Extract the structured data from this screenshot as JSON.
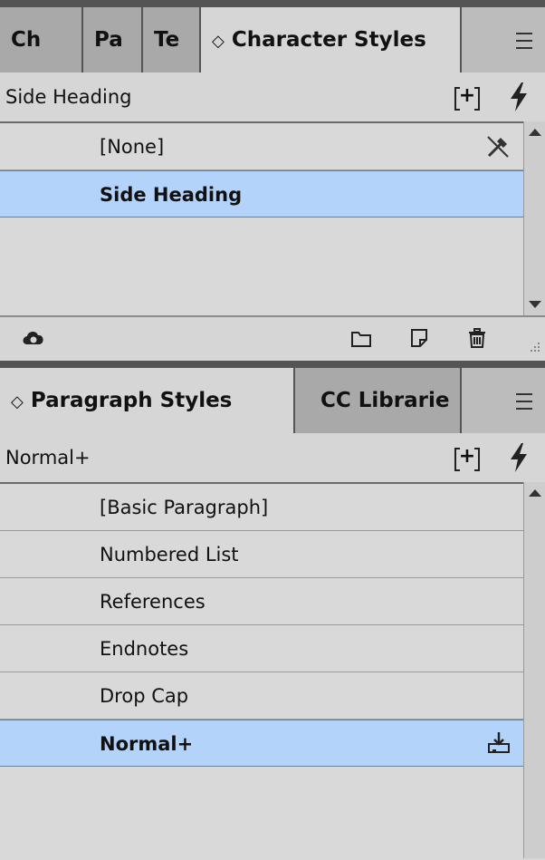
{
  "character_panel": {
    "tabs": [
      {
        "label": "Ch"
      },
      {
        "label": "Pa"
      },
      {
        "label": "Te"
      },
      {
        "label": "Character Styles",
        "chevron": "◇"
      }
    ],
    "current_style": "Side Heading",
    "items": [
      {
        "label": "[None]"
      },
      {
        "label": "Side Heading"
      }
    ],
    "footer_icons": [
      "creative-cloud-icon",
      "folder-icon",
      "new-style-icon",
      "trash-icon"
    ]
  },
  "paragraph_panel": {
    "tabs": [
      {
        "label": "Paragraph Styles",
        "chevron": "◇"
      },
      {
        "label": "CC Librarie"
      }
    ],
    "current_style": "Normal+",
    "items": [
      {
        "label": "[Basic Paragraph]"
      },
      {
        "label": "Numbered List"
      },
      {
        "label": "References"
      },
      {
        "label": "Endnotes"
      },
      {
        "label": "Drop Cap"
      },
      {
        "label": "Normal+"
      }
    ]
  },
  "colors": {
    "selection": "#b4d3fb",
    "panel_bg": "#d6d6d6",
    "tab_bg": "#a9a9a9"
  }
}
